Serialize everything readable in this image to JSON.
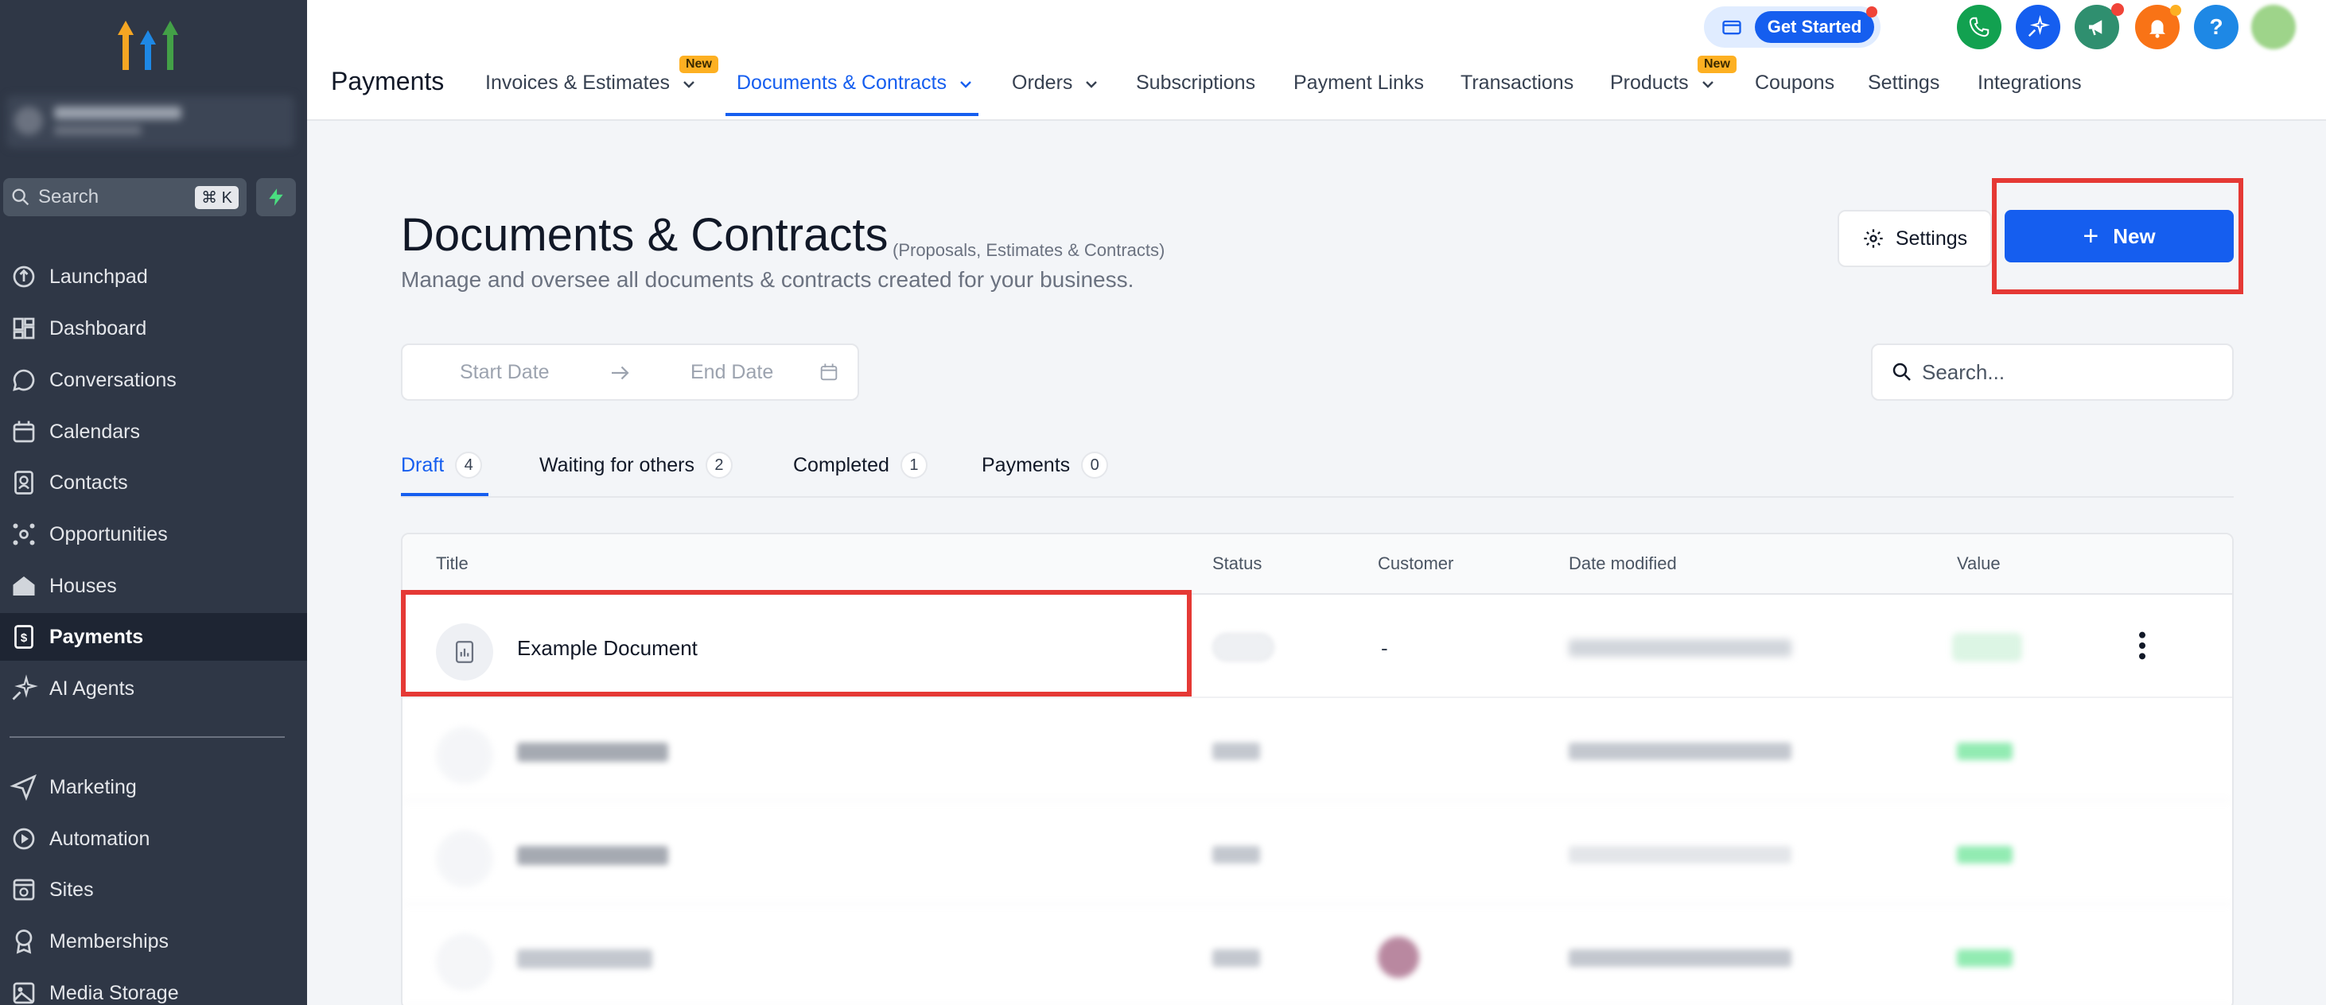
{
  "sidebar": {
    "search_placeholder": "Search",
    "search_shortcut": "⌘ K",
    "items": [
      {
        "label": "Launchpad",
        "icon": "launchpad-icon"
      },
      {
        "label": "Dashboard",
        "icon": "dashboard-icon"
      },
      {
        "label": "Conversations",
        "icon": "chat-icon"
      },
      {
        "label": "Calendars",
        "icon": "calendar-icon"
      },
      {
        "label": "Contacts",
        "icon": "contacts-icon"
      },
      {
        "label": "Opportunities",
        "icon": "opportunities-icon"
      },
      {
        "label": "Houses",
        "icon": "house-icon"
      },
      {
        "label": "Payments",
        "icon": "payments-icon",
        "active": true
      },
      {
        "label": "AI Agents",
        "icon": "ai-sparkle-icon"
      },
      {
        "label": "Marketing",
        "icon": "send-icon"
      },
      {
        "label": "Automation",
        "icon": "automation-icon"
      },
      {
        "label": "Sites",
        "icon": "sites-icon"
      },
      {
        "label": "Memberships",
        "icon": "membership-icon"
      },
      {
        "label": "Media Storage",
        "icon": "image-icon"
      }
    ]
  },
  "header": {
    "app_title": "Payments",
    "get_started": "Get Started",
    "new_badge": "New",
    "tabs": [
      {
        "label": "Invoices & Estimates",
        "dropdown": true,
        "badge": "New"
      },
      {
        "label": "Documents & Contracts",
        "dropdown": true,
        "active": true
      },
      {
        "label": "Orders",
        "dropdown": true
      },
      {
        "label": "Subscriptions"
      },
      {
        "label": "Payment Links"
      },
      {
        "label": "Transactions"
      },
      {
        "label": "Products",
        "dropdown": true,
        "badge": "New"
      },
      {
        "label": "Coupons"
      },
      {
        "label": "Settings"
      },
      {
        "label": "Integrations"
      }
    ],
    "action_icons": [
      "phone-icon",
      "ai-magic-icon",
      "megaphone-icon",
      "bell-icon",
      "help-icon",
      "user-avatar"
    ],
    "help_glyph": "?"
  },
  "main": {
    "title": "Documents & Contracts",
    "subtitle": "(Proposals, Estimates & Contracts)",
    "description": "Manage and oversee all documents & contracts created for your business.",
    "settings_label": "Settings",
    "new_label": "New",
    "new_plus": "+",
    "start_date_placeholder": "Start Date",
    "end_date_placeholder": "End Date",
    "search_placeholder": "Search...",
    "tabs": [
      {
        "label": "Draft",
        "count": "4",
        "active": true
      },
      {
        "label": "Waiting for others",
        "count": "2"
      },
      {
        "label": "Completed",
        "count": "1"
      },
      {
        "label": "Payments",
        "count": "0"
      }
    ],
    "table": {
      "columns": [
        "Title",
        "Status",
        "Customer",
        "Date modified",
        "Value"
      ],
      "rows": [
        {
          "title": "Example Document",
          "customer": "-"
        }
      ]
    }
  },
  "colors": {
    "primary": "#155eef",
    "sidebar_bg": "#2f3746",
    "annotation_red": "#e53935",
    "badge_yellow": "#fdb022"
  }
}
